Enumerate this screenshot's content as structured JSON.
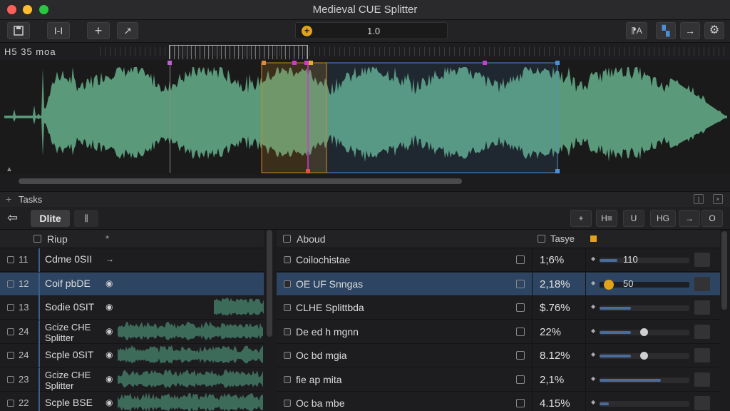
{
  "window": {
    "title": "Medieval CUE Splitter"
  },
  "toolbar": {
    "save_icon": "save-icon",
    "trim_label": "I-I",
    "add_label": "+",
    "expand_label": "↗",
    "zoom_value": "1.0",
    "text_tool_label": "⁋A",
    "marker_label": "▚",
    "next_label": "→",
    "gear_label": "⚙"
  },
  "ruler": {
    "label": "H5 35  moa"
  },
  "waveform": {
    "color": "#5a9a7a",
    "selection_color": "#4a90d9",
    "region_color": "#d18a1f",
    "playhead_color": "#d13ad1"
  },
  "tasks": {
    "label": "Tasks",
    "plus": "+"
  },
  "subtoolbar": {
    "tab_active": "Dlite",
    "tab_inactive": "⫼",
    "right_buttons": [
      "+",
      "H≡",
      "U",
      "HG",
      "→",
      "O"
    ]
  },
  "left_list": {
    "header": "Riup",
    "header_star": "*",
    "rows": [
      {
        "num": "□ 11",
        "name": "Cdme 0SII",
        "eye": "→",
        "selected": false,
        "wave": false
      },
      {
        "num": "□ 12",
        "name": "Coif pbDE",
        "eye": "👁",
        "selected": true,
        "wave": false
      },
      {
        "num": "□ 13",
        "name": "Sodie 0SIT",
        "eye": "👁",
        "selected": false,
        "wave": true
      },
      {
        "num": "□ 24",
        "name": "Gcize CHE\nSplitter",
        "eye": "👁",
        "selected": false,
        "wave": true
      },
      {
        "num": "□ 24",
        "name": "Scple 0SIT",
        "eye": "👁",
        "selected": false,
        "wave": true
      },
      {
        "num": "□ 23",
        "name": "Gcize CHE\nSplitter",
        "eye": "👁",
        "selected": false,
        "wave": true
      },
      {
        "num": "□ 22",
        "name": "Scple BSE",
        "eye": "👁",
        "selected": false,
        "wave": true
      }
    ]
  },
  "right_list": {
    "header": "Aboud",
    "header2": "Tasye",
    "rows": [
      {
        "about": "Coilochistae",
        "pct": "1;6%",
        "slider": 0.2,
        "knob": null,
        "value": "110",
        "selected": false
      },
      {
        "about": "OE UF Snngas",
        "pct": "2,18%",
        "slider": 0.0,
        "knob": 0.05,
        "value": "50",
        "selected": true
      },
      {
        "about": "CLHE Splittbda",
        "pct": "$.76%",
        "slider": 0.35,
        "knob": null,
        "value": "",
        "selected": false
      },
      {
        "about": "De ed h mgnn",
        "pct": "22%",
        "slider": 0.35,
        "knob": 0.45,
        "value": "",
        "selected": false
      },
      {
        "about": "Oc bd mgia",
        "pct": "8.12%",
        "slider": 0.35,
        "knob": 0.45,
        "value": "",
        "selected": false
      },
      {
        "about": "fie ap mita",
        "pct": "2,1%",
        "slider": 0.68,
        "knob": null,
        "value": "",
        "selected": false
      },
      {
        "about": "Oc ba mbe",
        "pct": "4.15%",
        "slider": 0.1,
        "knob": null,
        "value": "",
        "selected": false
      }
    ]
  }
}
